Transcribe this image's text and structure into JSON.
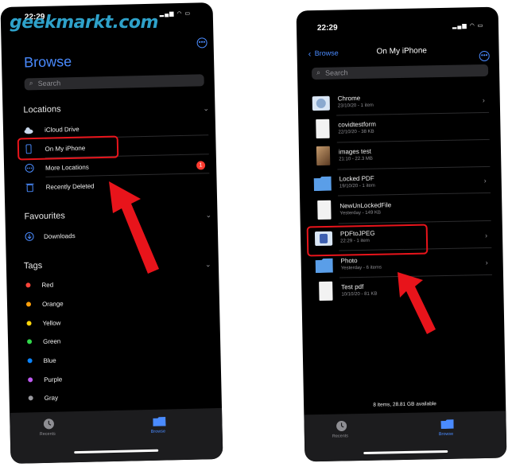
{
  "watermark": "geekmarkt.com",
  "left": {
    "time": "22:29",
    "title": "Browse",
    "search_placeholder": "Search",
    "locations_header": "Locations",
    "locations": [
      "iCloud Drive",
      "On My iPhone",
      "More Locations",
      "Recently Deleted"
    ],
    "deleted_badge": "1",
    "favourites_header": "Favourites",
    "favourites": [
      "Downloads"
    ],
    "tags_header": "Tags",
    "tags": [
      {
        "label": "Red",
        "color": "#ff453a"
      },
      {
        "label": "Orange",
        "color": "#ff9f0a"
      },
      {
        "label": "Yellow",
        "color": "#ffd60a"
      },
      {
        "label": "Green",
        "color": "#32d74b"
      },
      {
        "label": "Blue",
        "color": "#0a84ff"
      },
      {
        "label": "Purple",
        "color": "#bf5af2"
      },
      {
        "label": "Gray",
        "color": "#98989d"
      }
    ],
    "tab_recents": "Recents",
    "tab_browse": "Browse"
  },
  "right": {
    "time": "22:29",
    "back_label": "Browse",
    "title": "On My iPhone",
    "search_placeholder": "Search",
    "files": [
      {
        "name": "Chrome",
        "meta": "23/10/20 - 1 item"
      },
      {
        "name": "covidtestform",
        "meta": "22/10/20 - 38 KB"
      },
      {
        "name": "images test",
        "meta": "21:10 - 22.3 MB"
      },
      {
        "name": "Locked PDF",
        "meta": "19/10/20 - 1 item"
      },
      {
        "name": "NewUnLockedFile",
        "meta": "Yesterday - 149 KB"
      },
      {
        "name": "PDFtoJPEG",
        "meta": "22:29 - 1 item"
      },
      {
        "name": "Photo",
        "meta": "Yesterday - 6 items"
      },
      {
        "name": "Test pdf",
        "meta": "10/10/20 - 81 KB"
      }
    ],
    "footer": "8 items, 28.81 GB available",
    "tab_recents": "Recents",
    "tab_browse": "Browse"
  },
  "colors": {
    "accent": "#4a8bff",
    "highlight_box": "#e8141b",
    "arrow": "#e8141b"
  }
}
